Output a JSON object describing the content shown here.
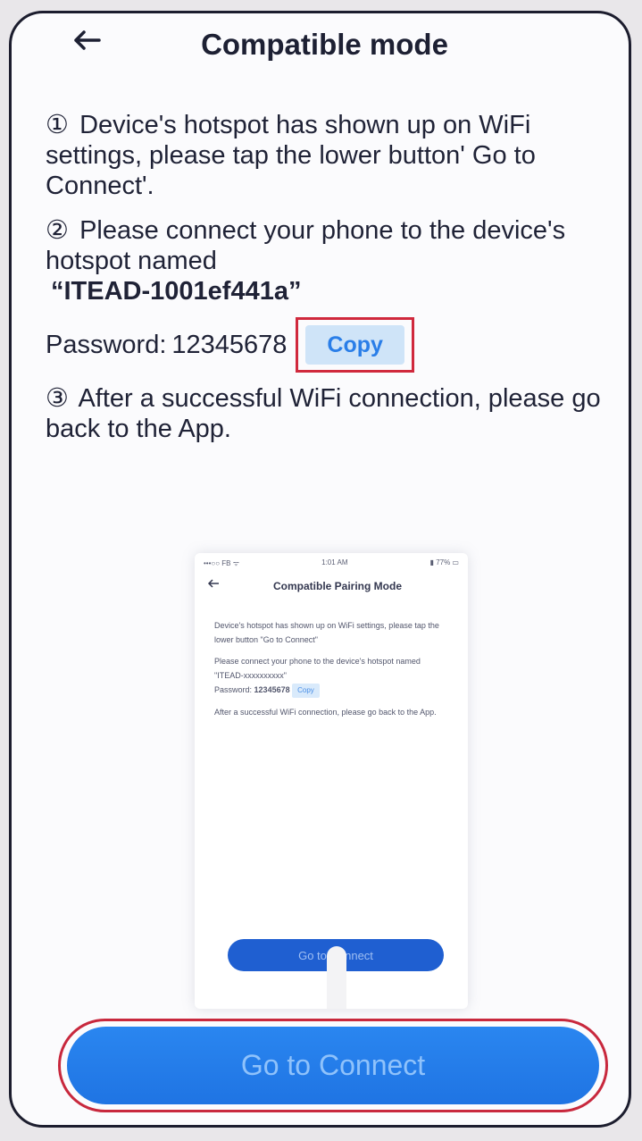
{
  "header": {
    "back_icon": "back-arrow-icon",
    "title": "Compatible mode"
  },
  "steps": [
    {
      "num": "①",
      "text": "Device's hotspot has shown up on WiFi settings, please tap the lower button' Go to Connect'."
    },
    {
      "num": "②",
      "text": "Please connect your phone to the device's hotspot named",
      "hotspot": "“ITEAD-1001ef441a”"
    },
    {
      "num": "③",
      "text": "After a successful WiFi connection, please go back to the App."
    }
  ],
  "password": {
    "label": "Password:",
    "value": "12345678",
    "copy_label": "Copy"
  },
  "preview": {
    "status_left": "•••○○ FB ᯤ",
    "status_center": "1:01 AM",
    "status_right": "▮ 77% ▭",
    "title": "Compatible Pairing Mode",
    "step1": "Device's hotspot has shown up on WiFi settings, please tap the lower button \"Go to Connect\"",
    "step2": "Please connect your phone to the device's hotspot named \"ITEAD-xxxxxxxxxx\"",
    "pw_label": "Password:",
    "pw_value": "12345678",
    "copy_label": "Copy",
    "step3": "After a successful WiFi connection, please go back to the App.",
    "button_label": "Go to Connect"
  },
  "main_button": {
    "label": "Go to Connect"
  },
  "colors": {
    "accent": "#1f74e3",
    "highlight_outline": "#c8283d",
    "text": "#1f2236"
  }
}
